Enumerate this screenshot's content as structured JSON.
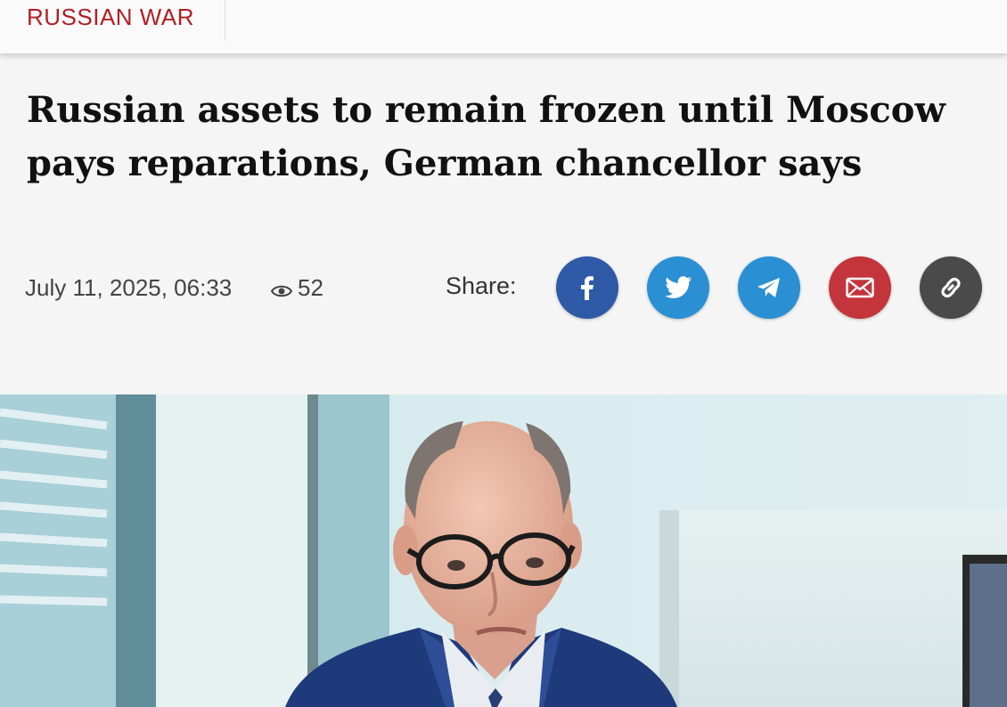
{
  "header": {
    "category": "RUSSIAN WAR"
  },
  "article": {
    "headline": "Russian assets to remain frozen until Moscow pays reparations, German chancellor says",
    "date": "July 11, 2025, 06:33",
    "views": "52"
  },
  "share": {
    "label": "Share:",
    "buttons": [
      {
        "name": "facebook",
        "icon": "facebook-icon",
        "color": "#2f5aa7"
      },
      {
        "name": "twitter",
        "icon": "twitter-icon",
        "color": "#2b8fd3"
      },
      {
        "name": "telegram",
        "icon": "telegram-icon",
        "color": "#2a8fd3"
      },
      {
        "name": "email",
        "icon": "mail-icon",
        "color": "#c4343b"
      },
      {
        "name": "copy-link",
        "icon": "link-icon",
        "color": "#4a4a4a"
      }
    ]
  },
  "colors": {
    "category": "#b01f24",
    "background": "#f5f5f5"
  }
}
